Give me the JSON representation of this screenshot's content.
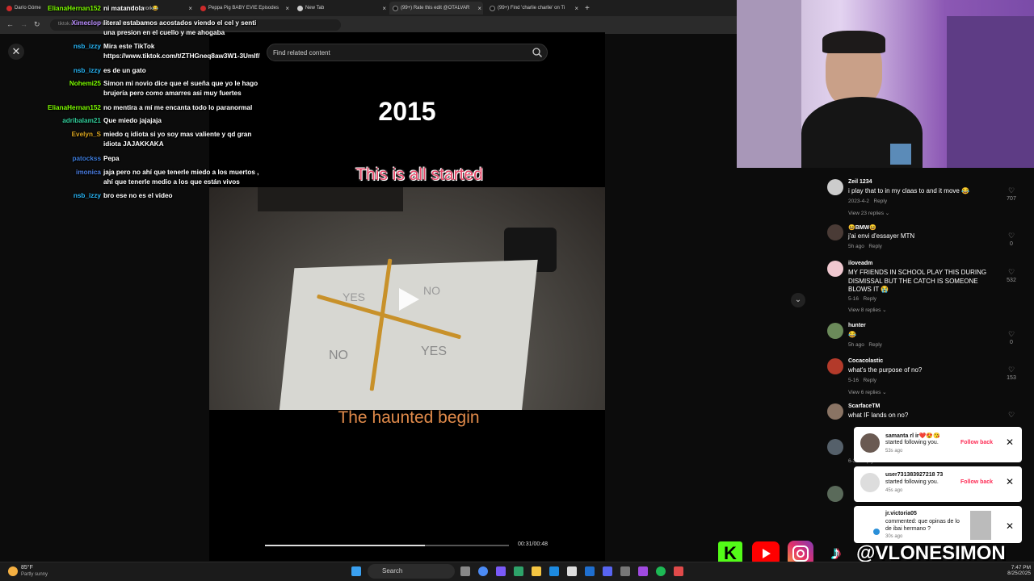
{
  "browser": {
    "tabs": [
      {
        "label": "Darío Góme",
        "fav": "#cc2a2a"
      },
      {
        "label": "al didn't work😂",
        "fav": "#cc2a2a"
      },
      {
        "label": "Peppa Pig BABY EVIE Episodes",
        "fav": "#cc2a2a"
      },
      {
        "label": "New Tab",
        "fav": "#cccccc"
      },
      {
        "label": "(99+) Rate this edit @OTALVAR",
        "fav": "#222222"
      },
      {
        "label": "(99+) Find 'charlie charlie' on Ti",
        "fav": "#222222"
      }
    ],
    "url": "tiktok.com/...charlie%20&t=1756165138038"
  },
  "chat": [
    {
      "user": "ElianaHernan152",
      "color": "#7fff00",
      "text": "ni matandola"
    },
    {
      "user": "Ximeclop",
      "color": "#b98cff",
      "text": "literal estabamos acostados viendo el cel y senti una presion en el cuello y me ahogaba"
    },
    {
      "user": "nsb_izzy",
      "color": "#29b6f6",
      "text": "Mira este TikTok https://www.tiktok.com/t/ZTHGneq8aw3W1-3Umlf/"
    },
    {
      "user": "nsb_izzy",
      "color": "#29b6f6",
      "text": "es de un gato"
    },
    {
      "user": "Nohemi25",
      "color": "#7cfc00",
      "text": "Simon mi novio dice que el sueña que yo le hago brujería pero como amarres asi muy fuertes"
    },
    {
      "user": "ElianaHernan152",
      "color": "#7fff00",
      "text": "no mentira a mí me encanta todo lo paranormal"
    },
    {
      "user": "adribalam21",
      "color": "#32cd9a",
      "text": "Que miedo jajajaja"
    },
    {
      "user": "Evelyn_S",
      "color": "#daa520",
      "text": "miedo q idiota si yo soy mas valiente y qd gran idiota JAJAKKAKA"
    },
    {
      "user": "patockss",
      "color": "#3d7bd9",
      "text": "Pepa"
    },
    {
      "user": "imonica",
      "color": "#4a7ce0",
      "text": "jaja pero no ahí que tenerle miedo a los muertos , ahí que tenerle medio a los que están vivos"
    },
    {
      "user": "nsb_izzy",
      "color": "#29b6f6",
      "text": "bro ese no es el video"
    }
  ],
  "search": {
    "placeholder": "Find related content"
  },
  "video": {
    "year": "2015",
    "caption_top": "This is all started",
    "caption_bottom": "The haunted begin",
    "paper_yes1": "YES",
    "paper_no1": "NO",
    "paper_no2": "NO",
    "paper_yes2": "YES",
    "time": "00:31/00:48",
    "progress": 0.655
  },
  "comments": [
    {
      "name": "Zeil 1234",
      "text": "i play that to in my claas to and it move 😂",
      "date": "2023-4-2",
      "reply": "Reply",
      "likes": "707",
      "replies": "View 23 replies",
      "avatar": "#cccccc"
    },
    {
      "name": "😆BMW😆",
      "text": "j'ai envi d'essayer MTN",
      "date": "5h ago",
      "reply": "Reply",
      "likes": "0",
      "replies": "",
      "avatar": "#4a3b36"
    },
    {
      "name": "iloveadm",
      "text": "MY FRIENDS IN SCHOOL PLAY THIS DURING DISMISSAL BUT THE CATCH IS SOMEONE BLOWS IT 😭",
      "date": "5-16",
      "reply": "Reply",
      "likes": "532",
      "replies": "View 8 replies",
      "avatar": "#f0c8d0"
    },
    {
      "name": "hunter",
      "text": "😂",
      "date": "5h ago",
      "reply": "Reply",
      "likes": "0",
      "replies": "",
      "avatar": "#6b8a5a"
    },
    {
      "name": "Cocacolastic",
      "text": "what's the purpose of no?",
      "date": "5-16",
      "reply": "Reply",
      "likes": "153",
      "replies": "View 6 replies",
      "avatar": "#b33a2a"
    },
    {
      "name": "ScarfaceTM",
      "text": "what IF lands on no?",
      "date": "",
      "reply": "",
      "likes": "",
      "replies": "",
      "avatar": "#8a7464"
    },
    {
      "name": "",
      "text": "",
      "date": "6-3",
      "reply": "Reply",
      "likes": "125",
      "replies": "",
      "avatar": "#55606a"
    }
  ],
  "notifications": [
    {
      "name": "samanta rl ir❤️😍😘",
      "action": "started following you.",
      "time": "53s ago",
      "button": "Follow back"
    },
    {
      "name": "user731383927218 73",
      "action": "started following you.",
      "time": "45s ago",
      "button": "Follow back"
    },
    {
      "name": "jr.victoria05",
      "action": "commented: que opinas de lo de ibai hermano ?",
      "time": "30s ago",
      "button": ""
    }
  ],
  "overlay": {
    "handle": "@VLONESIMON"
  },
  "taskbar": {
    "temp": "85°F",
    "weather": "Partly sunny",
    "search": "Search",
    "time": "7:47 PM",
    "date": "8/25/2025"
  }
}
